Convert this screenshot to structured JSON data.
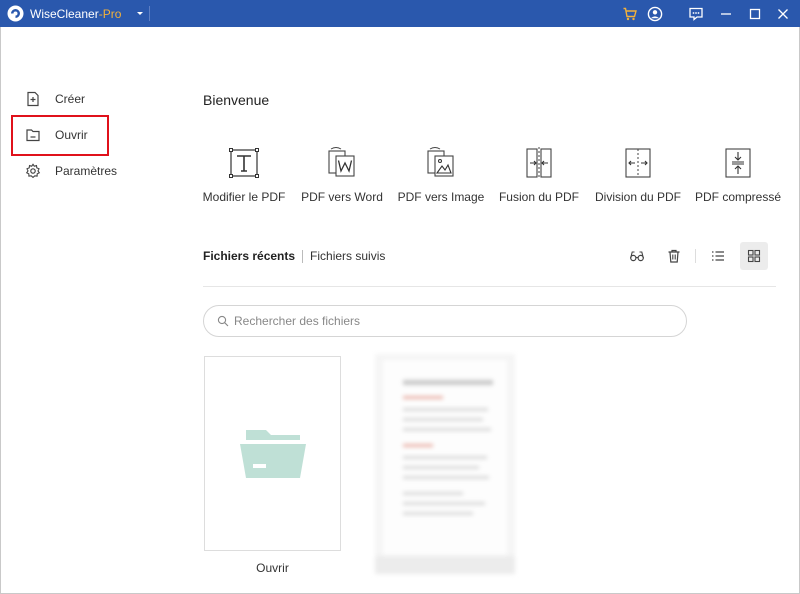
{
  "titlebar": {
    "app_name": "WiseCleaner",
    "app_suffix": "-Pro",
    "suffix_color": "#f2b13b",
    "bg_color": "#2a58ad",
    "icons": [
      "app-logo-icon",
      "dropdown-icon",
      "cart-icon",
      "user-icon",
      "feedback-icon",
      "minimize-icon",
      "maximize-icon",
      "close-icon"
    ]
  },
  "sidebar": {
    "items": [
      {
        "label": "Créer",
        "icon": "create-file-icon"
      },
      {
        "label": "Ouvrir",
        "icon": "open-folder-icon"
      },
      {
        "label": "Paramètres",
        "icon": "gear-icon"
      }
    ],
    "highlight_color": "#e0111b"
  },
  "main": {
    "welcome": "Bienvenue",
    "tools": [
      {
        "label": "Modifier le PDF",
        "icon": "edit-text-icon"
      },
      {
        "label": "PDF vers Word",
        "icon": "pdf-to-word-icon"
      },
      {
        "label": "PDF vers Image",
        "icon": "pdf-to-image-icon"
      },
      {
        "label": "Fusion du PDF",
        "icon": "merge-pdf-icon"
      },
      {
        "label": "Division du PDF",
        "icon": "split-pdf-icon"
      },
      {
        "label": "PDF compressé",
        "icon": "compress-pdf-icon"
      }
    ],
    "tabs": {
      "recent": "Fichiers récents",
      "followed": "Fichiers suivis"
    },
    "actions": [
      "reading-glasses-icon",
      "trash-icon",
      "list-view-icon",
      "grid-view-icon"
    ],
    "search": {
      "placeholder": "Rechercher des fichiers",
      "value": ""
    },
    "open_card": {
      "label": "Ouvrir",
      "folder_color": "#bfe0d6"
    }
  }
}
